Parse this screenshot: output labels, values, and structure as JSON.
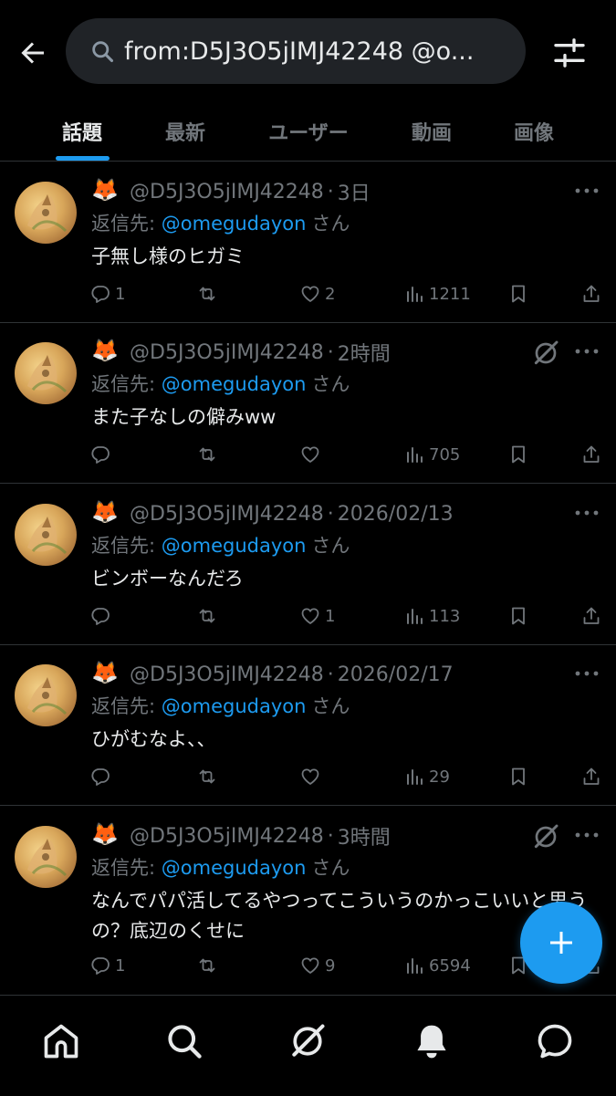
{
  "search": {
    "query": "from:D5J3O5jIMJ42248 @o..."
  },
  "tabs": [
    {
      "label": "話題",
      "active": true
    },
    {
      "label": "最新",
      "active": false
    },
    {
      "label": "ユーザー",
      "active": false
    },
    {
      "label": "動画",
      "active": false
    },
    {
      "label": "画像",
      "active": false
    }
  ],
  "posts": [
    {
      "emoji": "🦊",
      "handle": "@D5J3O5jIMJ42248",
      "time": "3日",
      "reply_prefix": "返信先: ",
      "reply_to": "@omegudayon",
      "reply_suffix": "さん",
      "text": "子無し様のヒガミ",
      "replies": "1",
      "reposts": "",
      "likes": "2",
      "views": "1211",
      "grok": false
    },
    {
      "emoji": "🦊",
      "handle": "@D5J3O5jIMJ42248",
      "time": "2時間",
      "reply_prefix": "返信先: ",
      "reply_to": "@omegudayon",
      "reply_suffix": "さん",
      "text": "また子なしの僻みww",
      "replies": "",
      "reposts": "",
      "likes": "",
      "views": "705",
      "grok": true
    },
    {
      "emoji": "🦊",
      "handle": "@D5J3O5jIMJ42248",
      "time": "2026/02/13",
      "reply_prefix": "返信先: ",
      "reply_to": "@omegudayon",
      "reply_suffix": "さん",
      "text": "ビンボーなんだろ",
      "replies": "",
      "reposts": "",
      "likes": "1",
      "views": "113",
      "grok": false
    },
    {
      "emoji": "🦊",
      "handle": "@D5J3O5jIMJ42248",
      "time": "2026/02/17",
      "reply_prefix": "返信先: ",
      "reply_to": "@omegudayon",
      "reply_suffix": "さん",
      "text": "ひがむなよ、、",
      "replies": "",
      "reposts": "",
      "likes": "",
      "views": "29",
      "grok": false
    },
    {
      "emoji": "🦊",
      "handle": "@D5J3O5jIMJ42248",
      "time": "3時間",
      "reply_prefix": "返信先: ",
      "reply_to": "@omegudayon",
      "reply_suffix": "さん",
      "text": "なんでパパ活してるやつってこういうのかっこいいと思うの？底辺のくせに",
      "replies": "1",
      "reposts": "",
      "likes": "9",
      "views": "6594",
      "grok": true
    }
  ],
  "icons": {
    "back": "arrow-left-icon",
    "search": "search-icon",
    "filter": "sliders-icon",
    "nav": [
      "home-icon",
      "search-icon",
      "grok-icon",
      "bell-icon",
      "message-icon"
    ],
    "fab": "plus-icon"
  },
  "colors": {
    "accent": "#1d9bf0",
    "background": "#000000",
    "muted": "#71767b",
    "text": "#e7e9ea"
  }
}
